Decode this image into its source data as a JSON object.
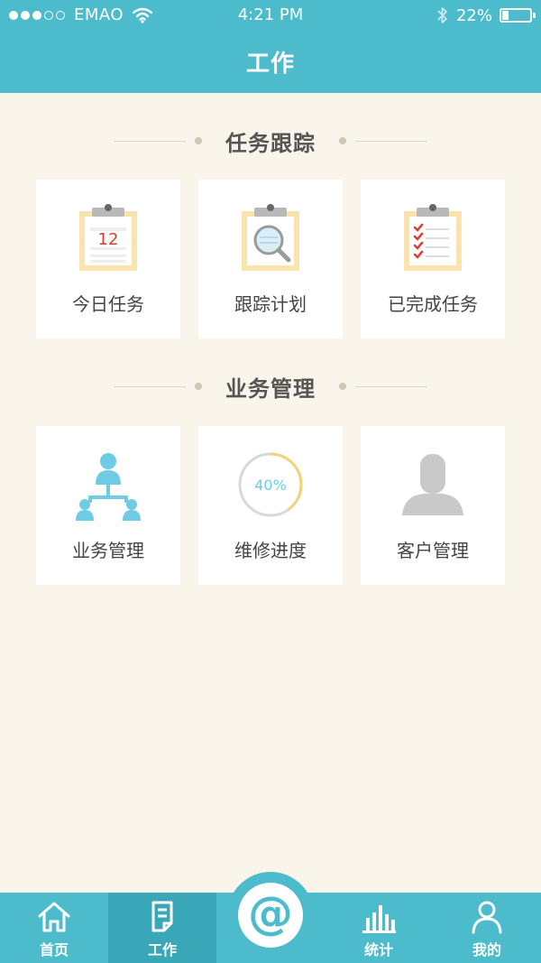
{
  "status_bar": {
    "carrier": "EMAO",
    "time": "4:21 PM",
    "battery_percent": "22%",
    "battery_level": 0.22,
    "signal_bars_filled": 3,
    "signal_bars_total": 5
  },
  "header": {
    "title": "工作"
  },
  "sections": {
    "task_tracking": {
      "title": "任务跟踪",
      "cards": [
        {
          "label": "今日任务",
          "icon": "calendar-clipboard-icon",
          "badge": "12"
        },
        {
          "label": "跟踪计划",
          "icon": "magnifier-clipboard-icon"
        },
        {
          "label": "已完成任务",
          "icon": "checklist-clipboard-icon"
        }
      ]
    },
    "business": {
      "title": "业务管理",
      "cards": [
        {
          "label": "业务管理",
          "icon": "org-chart-icon"
        },
        {
          "label": "维修进度",
          "icon": "progress-ring-icon",
          "progress_text": "40%",
          "progress": 0.4
        },
        {
          "label": "客户管理",
          "icon": "person-silhouette-icon"
        }
      ]
    }
  },
  "tabbar": {
    "items": [
      {
        "label": "首页",
        "icon": "home-icon"
      },
      {
        "label": "工作",
        "icon": "document-icon",
        "active": true
      },
      {
        "label": "",
        "icon": "at-sign-icon",
        "symbol": "@"
      },
      {
        "label": "统计",
        "icon": "bar-chart-icon"
      },
      {
        "label": "我的",
        "icon": "user-icon"
      }
    ]
  },
  "colors": {
    "primary": "#4cbccd",
    "primary_dark": "#3aa7b8",
    "background": "#faf5ea",
    "card": "#ffffff",
    "clipboard": "#fbe3b0",
    "accent_red": "#e03a2f",
    "accent_blue": "#6ecbe6"
  }
}
